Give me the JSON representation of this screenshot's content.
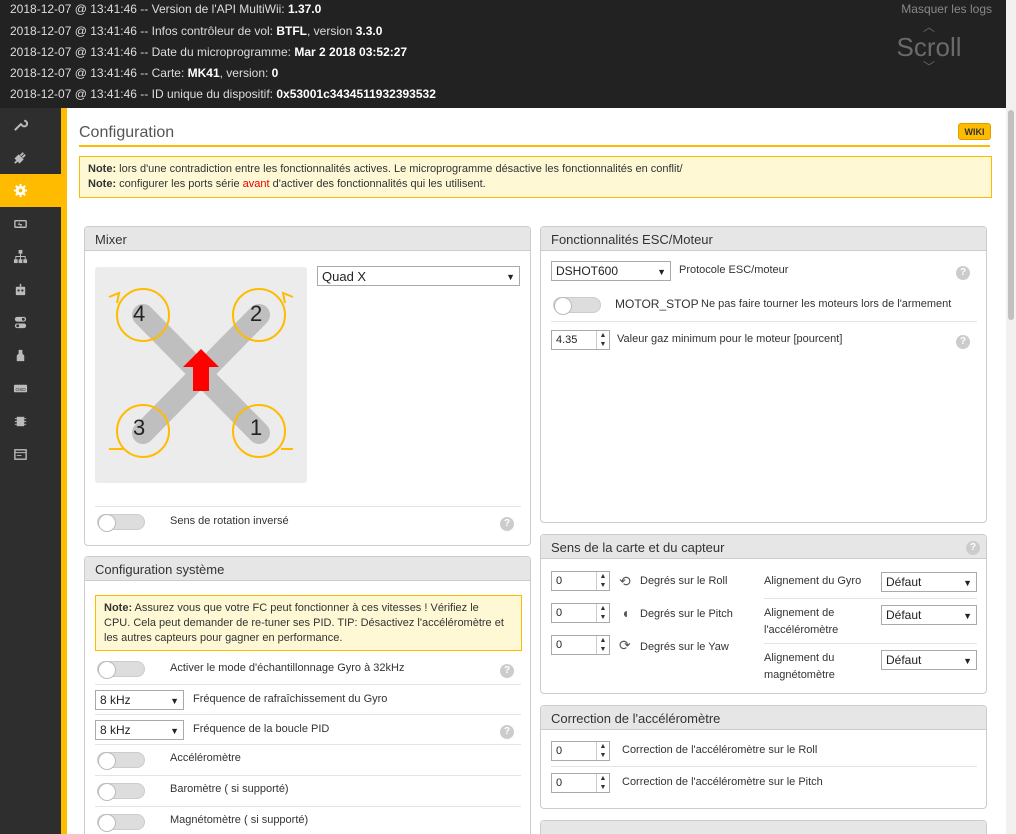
{
  "log": {
    "lines": [
      {
        "ts": "2018-12-07 @ 13:41:46",
        "text": " -- Version de l'API MultiWii: ",
        "val": "1.37.0",
        "tail": ""
      },
      {
        "ts": "2018-12-07 @ 13:41:46",
        "text": " -- Infos contrôleur de vol: ",
        "val": "BTFL",
        "tail": ", version ",
        "val2": "3.3.0"
      },
      {
        "ts": "2018-12-07 @ 13:41:46",
        "text": " -- Date du microprogramme: ",
        "val": "Mar 2 2018 03:52:27",
        "tail": ""
      },
      {
        "ts": "2018-12-07 @ 13:41:46",
        "text": " -- Carte: ",
        "val": "MK41",
        "tail": ", version: ",
        "val2": "0"
      },
      {
        "ts": "2018-12-07 @ 13:41:46",
        "text": " -- ID unique du dispositif: ",
        "val": "0x53001c3434511932393532",
        "tail": ""
      }
    ],
    "hide_label": "Masquer les logs",
    "scroll_label": "Scroll"
  },
  "sidebar": [
    "wrench-icon",
    "plug-icon",
    "gear-icon",
    "battery-icon",
    "network-icon",
    "robot-icon",
    "toggles-icon",
    "bottle-icon",
    "osd-icon",
    "chip-icon",
    "window-icon"
  ],
  "page": {
    "title": "Configuration",
    "wiki": "WIKI"
  },
  "note_top": {
    "l1_b": "Note:",
    "l1": " lors d'une contradiction entre les fonctionnalités actives. Le microprogramme désactive les fonctionnalités en conflit/",
    "l2_b": "Note:",
    "l2a": " configurer les ports série ",
    "l2_red": "avant",
    "l2b": " d'activer des fonctionnalités qui les utilisent."
  },
  "mixer": {
    "title": "Mixer",
    "select": "Quad X",
    "motors": [
      "4",
      "2",
      "3",
      "1"
    ],
    "reverse_label": "Sens de rotation inversé",
    "help": "?"
  },
  "esc": {
    "title": "Fonctionnalités ESC/Moteur",
    "protocol_value": "DSHOT600",
    "protocol_label": "Protocole ESC/moteur",
    "motor_stop": "MOTOR_STOP",
    "motor_stop_desc": "Ne pas faire tourner les moteurs lors de l'armement",
    "min_throttle_value": "4.35",
    "min_throttle_label": "Valeur gaz minimum pour le moteur [pourcent]",
    "help": "?"
  },
  "align": {
    "title": "Sens de la carte et du capteur",
    "help": "?",
    "roll_val": "0",
    "roll_label": "Degrés sur le Roll",
    "pitch_val": "0",
    "pitch_label": "Degrés sur le Pitch",
    "yaw_val": "0",
    "yaw_label": "Degrés sur le Yaw",
    "gyro_label": "Alignement du Gyro",
    "gyro_val": "Défaut",
    "acc_label1": "Alignement de",
    "acc_label2": "l'accéléromètre",
    "acc_val": "Défaut",
    "mag_label1": "Alignement du",
    "mag_label2": "magnétomètre",
    "mag_val": "Défaut"
  },
  "acc_trim": {
    "title": "Correction de l'accéléromètre",
    "roll_val": "0",
    "roll_label": "Correction de l'accéléromètre sur le Roll",
    "pitch_val": "0",
    "pitch_label": "Correction de l'accéléromètre sur le Pitch"
  },
  "system": {
    "title": "Configuration système",
    "note_b": "Note:",
    "note_l1": " Assurez vous que votre FC peut fonctionner à ces vitesses ! Vérifiez le",
    "note_l2": "CPU. Cela peut demander de re-tuner ses PID. TIP: Désactivez l'accéléromètre et",
    "note_l3": "les autres capteurs pour gagner en performance.",
    "gyro32": "Activer le mode d'échantillonnage Gyro à 32kHz",
    "gyro_freq_val": "8 kHz",
    "gyro_freq_label": "Fréquence de rafraîchissement du Gyro",
    "pid_freq_val": "8 kHz",
    "pid_freq_label": "Fréquence de la boucle PID",
    "acc": "Accéléromètre",
    "baro": "Baromètre ( si supporté)",
    "mag": "Magnétomètre ( si supporté)",
    "help": "?"
  }
}
